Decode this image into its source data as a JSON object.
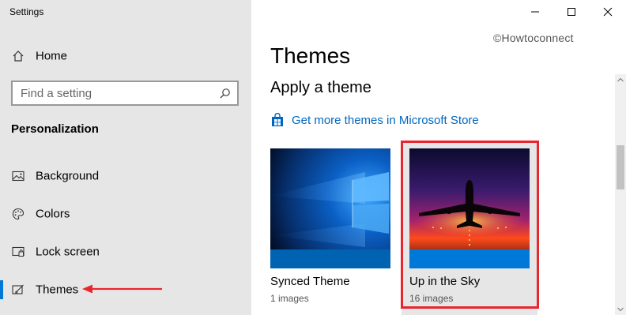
{
  "window": {
    "title": "Settings",
    "controls": {
      "minimize": "minimize-icon",
      "maximize": "maximize-icon",
      "close": "close-icon"
    }
  },
  "sidebar": {
    "home": {
      "label": "Home",
      "icon": "home-icon"
    },
    "search": {
      "placeholder": "Find a setting",
      "icon": "search-icon"
    },
    "section_heading": "Personalization",
    "items": [
      {
        "label": "Background",
        "icon": "picture-icon",
        "active": false
      },
      {
        "label": "Colors",
        "icon": "palette-icon",
        "active": false
      },
      {
        "label": "Lock screen",
        "icon": "lock-screen-icon",
        "active": false
      },
      {
        "label": "Themes",
        "icon": "brush-icon",
        "active": true
      }
    ],
    "accent_color": "#0078d7",
    "annotation_arrow_color": "#e8262f"
  },
  "main": {
    "watermark": "©Howtoconnect",
    "title": "Themes",
    "subtitle": "Apply a theme",
    "store_link": {
      "label": "Get more themes in Microsoft Store",
      "icon": "store-bag-icon",
      "color": "#0067c0"
    },
    "themes": [
      {
        "name": "Synced Theme",
        "count": "1 images",
        "accent": "#0063b1",
        "selected": false
      },
      {
        "name": "Up in the Sky",
        "count": "16 images",
        "accent": "#0078d7",
        "selected": true
      }
    ],
    "highlight_color": "#e8262f"
  }
}
